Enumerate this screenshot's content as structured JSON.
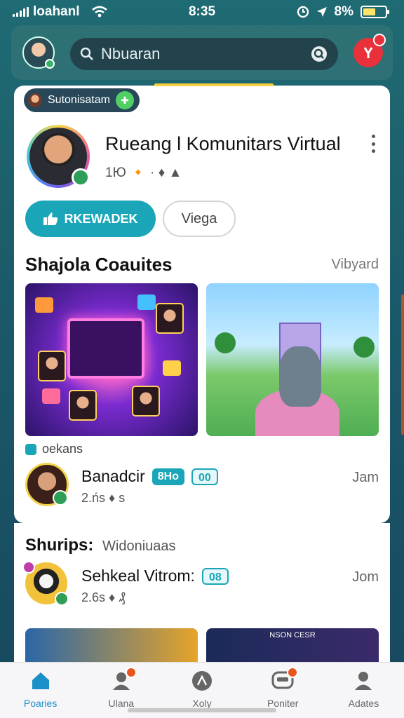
{
  "status_bar": {
    "carrier": "loahanl",
    "time": "8:35",
    "battery": "8%",
    "battery_level": 0.55
  },
  "header": {
    "search_placeholder": "Nbuaran"
  },
  "group_card": {
    "chip_label": "Sutonisatam",
    "title": "Rueang l Komunitars Virtual",
    "meta": "1Ю 🔸 · ♦ ▲",
    "primary_button": "RKEWADEK",
    "secondary_button": "Viega",
    "section_title": "Shajola Coauites",
    "section_link": "Vibyard",
    "section_sub": "oekans",
    "member": {
      "name": "Banadcir",
      "tag1": "8Ho",
      "tag2": "00",
      "meta": "2.ńs ♦ ѕ",
      "join": "Jam"
    }
  },
  "lower_section": {
    "title": "Shurips:",
    "subtitle": "Widoniuaas",
    "row": {
      "name": "Sehkeal Vitrom:",
      "tag": "08",
      "meta": "2.6s ♦ ₰",
      "join": "Jom"
    },
    "banner2_text": "NSON CESR"
  },
  "bottom_nav": {
    "items": [
      {
        "label": "Poaries",
        "icon": "home-icon"
      },
      {
        "label": "Ulana",
        "icon": "profile-icon"
      },
      {
        "label": "Xoly",
        "icon": "compass-icon"
      },
      {
        "label": "Poniter",
        "icon": "chat-icon"
      },
      {
        "label": "Adates",
        "icon": "person-icon"
      }
    ]
  },
  "colors": {
    "accent": "#1aa6b8",
    "active_nav": "#1a8fc8",
    "alert": "#e8313a"
  }
}
